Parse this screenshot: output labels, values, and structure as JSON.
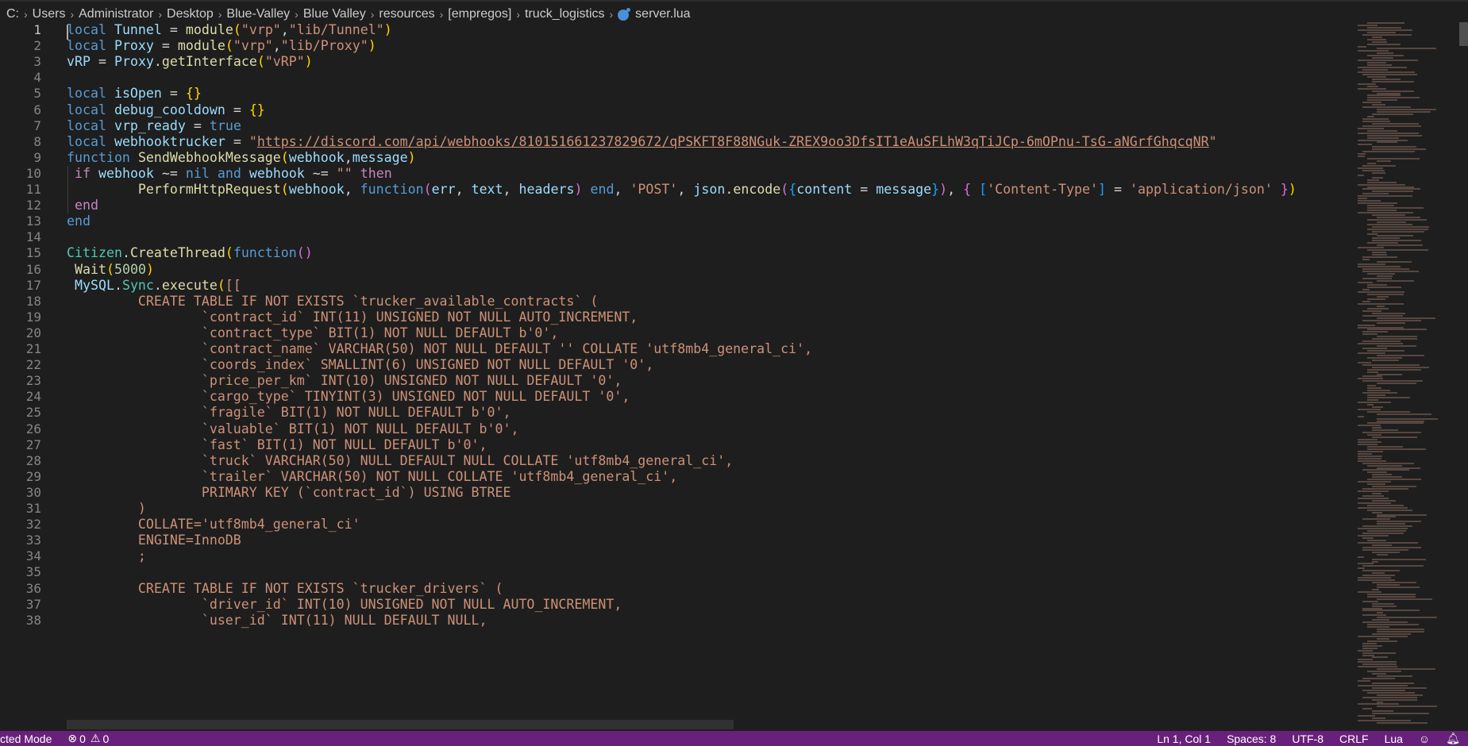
{
  "breadcrumb": {
    "drive": "C:",
    "items": [
      "Users",
      "Administrator",
      "Desktop",
      "Blue-Valley",
      "Blue Valley",
      "resources",
      "[empregos]",
      "truck_logistics"
    ],
    "file": "server.lua"
  },
  "editor": {
    "active_line": 1,
    "lines": [
      {
        "n": "1",
        "t": [
          [
            "kw",
            "local"
          ],
          [
            "op",
            " "
          ],
          [
            "var",
            "Tunnel"
          ],
          [
            "op",
            " = "
          ],
          [
            "fn",
            "module"
          ],
          [
            "p1",
            "("
          ],
          [
            "str",
            "\"vrp\""
          ],
          [
            "op",
            ","
          ],
          [
            "str",
            "\"lib/Tunnel\""
          ],
          [
            "p1",
            ")"
          ]
        ]
      },
      {
        "n": "2",
        "t": [
          [
            "kw",
            "local"
          ],
          [
            "op",
            " "
          ],
          [
            "var",
            "Proxy"
          ],
          [
            "op",
            " = "
          ],
          [
            "fn",
            "module"
          ],
          [
            "p1",
            "("
          ],
          [
            "str",
            "\"vrp\""
          ],
          [
            "op",
            ","
          ],
          [
            "str",
            "\"lib/Proxy\""
          ],
          [
            "p1",
            ")"
          ]
        ]
      },
      {
        "n": "3",
        "t": [
          [
            "var",
            "vRP"
          ],
          [
            "op",
            " = "
          ],
          [
            "var",
            "Proxy"
          ],
          [
            "op",
            "."
          ],
          [
            "fn",
            "getInterface"
          ],
          [
            "p1",
            "("
          ],
          [
            "str",
            "\"vRP\""
          ],
          [
            "p1",
            ")"
          ]
        ]
      },
      {
        "n": "4",
        "t": []
      },
      {
        "n": "5",
        "t": [
          [
            "kw",
            "local"
          ],
          [
            "op",
            " "
          ],
          [
            "var",
            "isOpen"
          ],
          [
            "op",
            " = "
          ],
          [
            "p1",
            "{}"
          ]
        ]
      },
      {
        "n": "6",
        "t": [
          [
            "kw",
            "local"
          ],
          [
            "op",
            " "
          ],
          [
            "var",
            "debug_cooldown"
          ],
          [
            "op",
            " = "
          ],
          [
            "p1",
            "{}"
          ]
        ]
      },
      {
        "n": "7",
        "t": [
          [
            "kw",
            "local"
          ],
          [
            "op",
            " "
          ],
          [
            "var",
            "vrp_ready"
          ],
          [
            "op",
            " = "
          ],
          [
            "kw",
            "true"
          ]
        ]
      },
      {
        "n": "8",
        "t": [
          [
            "kw",
            "local"
          ],
          [
            "op",
            " "
          ],
          [
            "var",
            "webhooktrucker"
          ],
          [
            "op",
            " = "
          ],
          [
            "str",
            "\""
          ],
          [
            "link",
            "https://discord.com/api/webhooks/810151661237829672/qPSKFT8F88NGuk-ZREX9oo3DfsIT1eAuSFLhW3qTiJCp-6mOPnu-TsG-aNGrfGhqcqNR"
          ],
          [
            "str",
            "\""
          ]
        ]
      },
      {
        "n": "9",
        "t": [
          [
            "kw",
            "function"
          ],
          [
            "op",
            " "
          ],
          [
            "fn",
            "SendWebhookMessage"
          ],
          [
            "p1",
            "("
          ],
          [
            "var",
            "webhook"
          ],
          [
            "op",
            ","
          ],
          [
            "var",
            "message"
          ],
          [
            "p1",
            ")"
          ]
        ]
      },
      {
        "n": "10",
        "t": [
          [
            "op",
            " "
          ],
          [
            "ctl",
            "if"
          ],
          [
            "op",
            " "
          ],
          [
            "var",
            "webhook"
          ],
          [
            "op",
            " ~= "
          ],
          [
            "kw",
            "nil"
          ],
          [
            "op",
            " "
          ],
          [
            "kw",
            "and"
          ],
          [
            "op",
            " "
          ],
          [
            "var",
            "webhook"
          ],
          [
            "op",
            " ~= "
          ],
          [
            "str",
            "\"\""
          ],
          [
            "op",
            " "
          ],
          [
            "ctl",
            "then"
          ]
        ]
      },
      {
        "n": "11",
        "t": [
          [
            "op",
            "         "
          ],
          [
            "fn",
            "PerformHttpRequest"
          ],
          [
            "p1",
            "("
          ],
          [
            "var",
            "webhook"
          ],
          [
            "op",
            ", "
          ],
          [
            "kw",
            "function"
          ],
          [
            "p2",
            "("
          ],
          [
            "var",
            "err"
          ],
          [
            "op",
            ", "
          ],
          [
            "var",
            "text"
          ],
          [
            "op",
            ", "
          ],
          [
            "var",
            "headers"
          ],
          [
            "p2",
            ")"
          ],
          [
            "op",
            " "
          ],
          [
            "kw",
            "end"
          ],
          [
            "op",
            ", "
          ],
          [
            "str",
            "'POST'"
          ],
          [
            "op",
            ", "
          ],
          [
            "var",
            "json"
          ],
          [
            "op",
            "."
          ],
          [
            "fn",
            "encode"
          ],
          [
            "p2",
            "("
          ],
          [
            "p3",
            "{"
          ],
          [
            "var",
            "content"
          ],
          [
            "op",
            " = "
          ],
          [
            "var",
            "message"
          ],
          [
            "p3",
            "}"
          ],
          [
            "p2",
            ")"
          ],
          [
            "op",
            ", "
          ],
          [
            "p2",
            "{"
          ],
          [
            "op",
            " "
          ],
          [
            "p3",
            "["
          ],
          [
            "str",
            "'Content-Type'"
          ],
          [
            "p3",
            "]"
          ],
          [
            "op",
            " = "
          ],
          [
            "str",
            "'application/json'"
          ],
          [
            "op",
            " "
          ],
          [
            "p2",
            "}"
          ],
          [
            "p1",
            ")"
          ]
        ]
      },
      {
        "n": "12",
        "t": [
          [
            "op",
            " "
          ],
          [
            "ctl",
            "end"
          ]
        ]
      },
      {
        "n": "13",
        "t": [
          [
            "kw",
            "end"
          ]
        ]
      },
      {
        "n": "14",
        "t": []
      },
      {
        "n": "15",
        "t": [
          [
            "cls",
            "Citizen"
          ],
          [
            "op",
            "."
          ],
          [
            "fn",
            "CreateThread"
          ],
          [
            "p1",
            "("
          ],
          [
            "kw",
            "function"
          ],
          [
            "p2",
            "()"
          ]
        ]
      },
      {
        "n": "16",
        "t": [
          [
            "op",
            " "
          ],
          [
            "fn",
            "Wait"
          ],
          [
            "p1",
            "("
          ],
          [
            "num",
            "5000"
          ],
          [
            "p1",
            ")"
          ]
        ]
      },
      {
        "n": "17",
        "t": [
          [
            "op",
            " "
          ],
          [
            "var",
            "MySQL"
          ],
          [
            "op",
            "."
          ],
          [
            "cls",
            "Sync"
          ],
          [
            "op",
            "."
          ],
          [
            "fn",
            "execute"
          ],
          [
            "p1",
            "("
          ],
          [
            "str",
            "[["
          ]
        ]
      },
      {
        "n": "18",
        "t": [
          [
            "str",
            "         CREATE TABLE IF NOT EXISTS `trucker_available_contracts` ("
          ]
        ]
      },
      {
        "n": "19",
        "t": [
          [
            "str",
            "                 `contract_id` INT(11) UNSIGNED NOT NULL AUTO_INCREMENT,"
          ]
        ]
      },
      {
        "n": "20",
        "t": [
          [
            "str",
            "                 `contract_type` BIT(1) NOT NULL DEFAULT b'0',"
          ]
        ]
      },
      {
        "n": "21",
        "t": [
          [
            "str",
            "                 `contract_name` VARCHAR(50) NOT NULL DEFAULT '' COLLATE 'utf8mb4_general_ci',"
          ]
        ]
      },
      {
        "n": "22",
        "t": [
          [
            "str",
            "                 `coords_index` SMALLINT(6) UNSIGNED NOT NULL DEFAULT '0',"
          ]
        ]
      },
      {
        "n": "23",
        "t": [
          [
            "str",
            "                 `price_per_km` INT(10) UNSIGNED NOT NULL DEFAULT '0',"
          ]
        ]
      },
      {
        "n": "24",
        "t": [
          [
            "str",
            "                 `cargo_type` TINYINT(3) UNSIGNED NOT NULL DEFAULT '0',"
          ]
        ]
      },
      {
        "n": "25",
        "t": [
          [
            "str",
            "                 `fragile` BIT(1) NOT NULL DEFAULT b'0',"
          ]
        ]
      },
      {
        "n": "26",
        "t": [
          [
            "str",
            "                 `valuable` BIT(1) NOT NULL DEFAULT b'0',"
          ]
        ]
      },
      {
        "n": "27",
        "t": [
          [
            "str",
            "                 `fast` BIT(1) NOT NULL DEFAULT b'0',"
          ]
        ]
      },
      {
        "n": "28",
        "t": [
          [
            "str",
            "                 `truck` VARCHAR(50) NULL DEFAULT NULL COLLATE 'utf8mb4_general_ci',"
          ]
        ]
      },
      {
        "n": "29",
        "t": [
          [
            "str",
            "                 `trailer` VARCHAR(50) NOT NULL COLLATE 'utf8mb4_general_ci',"
          ]
        ]
      },
      {
        "n": "30",
        "t": [
          [
            "str",
            "                 PRIMARY KEY (`contract_id`) USING BTREE"
          ]
        ]
      },
      {
        "n": "31",
        "t": [
          [
            "str",
            "         )"
          ]
        ]
      },
      {
        "n": "32",
        "t": [
          [
            "str",
            "         COLLATE='utf8mb4_general_ci'"
          ]
        ]
      },
      {
        "n": "33",
        "t": [
          [
            "str",
            "         ENGINE=InnoDB"
          ]
        ]
      },
      {
        "n": "34",
        "t": [
          [
            "str",
            "         ;"
          ]
        ]
      },
      {
        "n": "35",
        "t": []
      },
      {
        "n": "36",
        "t": [
          [
            "str",
            "         CREATE TABLE IF NOT EXISTS `trucker_drivers` ("
          ]
        ]
      },
      {
        "n": "37",
        "t": [
          [
            "str",
            "                 `driver_id` INT(10) UNSIGNED NOT NULL AUTO_INCREMENT,"
          ]
        ]
      },
      {
        "n": "38",
        "t": [
          [
            "str",
            "                 `user_id` INT(11) NULL DEFAULT NULL,"
          ]
        ]
      }
    ]
  },
  "statusbar": {
    "mode": "cted Mode",
    "errors": "0",
    "warnings": "0",
    "position": "Ln 1, Col 1",
    "spaces": "Spaces: 8",
    "encoding": "UTF-8",
    "eol": "CRLF",
    "language": "Lua"
  },
  "colors": {
    "statusbar_bg": "#68217a",
    "editor_bg": "#1e1e1e",
    "keyword": "#569cd6",
    "string": "#ce9178",
    "function": "#dcdcaa",
    "variable": "#9cdcfe"
  }
}
